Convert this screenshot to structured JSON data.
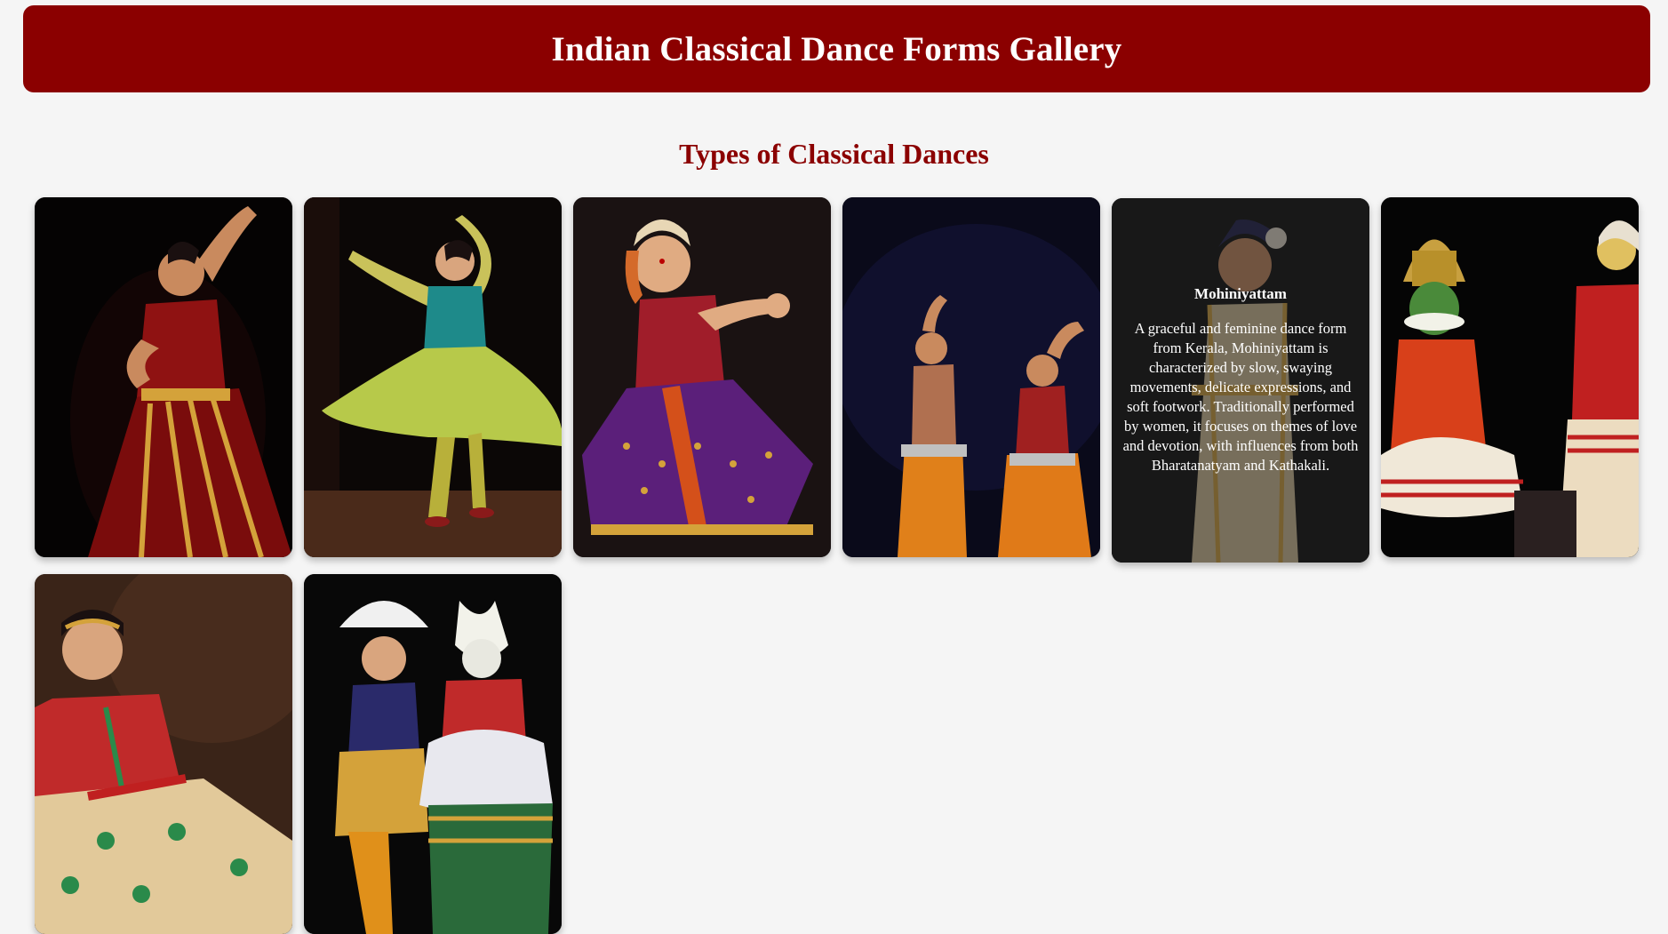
{
  "header": {
    "title": "Indian Classical Dance Forms Gallery"
  },
  "section": {
    "title": "Types of Classical Dances"
  },
  "colors": {
    "brand": "#8b0000",
    "background": "#f5f5f5"
  },
  "gallery": {
    "items": [
      {
        "image": "bharatanatyam-dancer-photo",
        "name": "",
        "description": ""
      },
      {
        "image": "kathak-dancer-photo",
        "name": "",
        "description": ""
      },
      {
        "image": "kuchipudi-dancer-photo",
        "name": "",
        "description": ""
      },
      {
        "image": "odissi-dancers-photo",
        "name": "",
        "description": ""
      },
      {
        "image": "mohiniyattam-dancer-photo",
        "name": "Mohiniyattam",
        "description": "A graceful and feminine dance form from Kerala, Mohiniyattam is characterized by slow, swaying movements, delicate expressions, and soft footwork. Traditionally performed by women, it focuses on themes of love and devotion, with influences from both Bharatanatyam and Kathakali."
      },
      {
        "image": "kathakali-dancers-photo",
        "name": "",
        "description": ""
      },
      {
        "image": "sattriya-dancer-photo",
        "name": "",
        "description": ""
      },
      {
        "image": "manipuri-dancers-photo",
        "name": "",
        "description": ""
      }
    ]
  }
}
